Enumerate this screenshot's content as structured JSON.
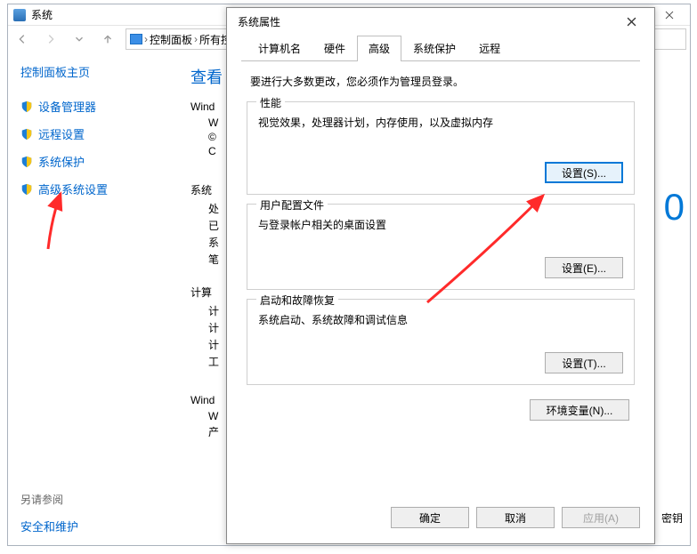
{
  "bgwin": {
    "title": "系统",
    "breadcrumb": {
      "seg1": "控制面板",
      "seg2": "所有控"
    }
  },
  "sidebar": {
    "heading": "控制面板主页",
    "items": [
      {
        "label": "设备管理器"
      },
      {
        "label": "远程设置"
      },
      {
        "label": "系统保护"
      },
      {
        "label": "高级系统设置"
      }
    ],
    "see_also_label": "另请参阅",
    "see_also_link": "安全和维护"
  },
  "main": {
    "heading": "查看",
    "line1": "Wind",
    "line2_1": "W",
    "line2_2": "©",
    "line2_3": "C",
    "big0": "0",
    "sect2": "系统",
    "s2_1": "处",
    "s2_2": "已",
    "s2_3": "系",
    "s2_4": "笔",
    "sect3": "计算",
    "s3_1": "计",
    "s3_2": "计",
    "s3_3": "计",
    "s3_4": "工",
    "sect4": "Wind",
    "s4_1": "W",
    "s4_2": "产",
    "bottom_right_partial": "密钥"
  },
  "dlg": {
    "title": "系统属性",
    "tabs": {
      "t1": "计算机名",
      "t2": "硬件",
      "t3": "高级",
      "t4": "系统保护",
      "t5": "远程"
    },
    "intro": "要进行大多数更改，您必须作为管理员登录。",
    "group1": {
      "legend": "性能",
      "text": "视觉效果，处理器计划，内存使用，以及虚拟内存",
      "btn": "设置(S)..."
    },
    "group2": {
      "legend": "用户配置文件",
      "text": "与登录帐户相关的桌面设置",
      "btn": "设置(E)..."
    },
    "group3": {
      "legend": "启动和故障恢复",
      "text": "系统启动、系统故障和调试信息",
      "btn": "设置(T)..."
    },
    "env_btn": "环境变量(N)...",
    "ok": "确定",
    "cancel": "取消",
    "apply": "应用(A)"
  }
}
